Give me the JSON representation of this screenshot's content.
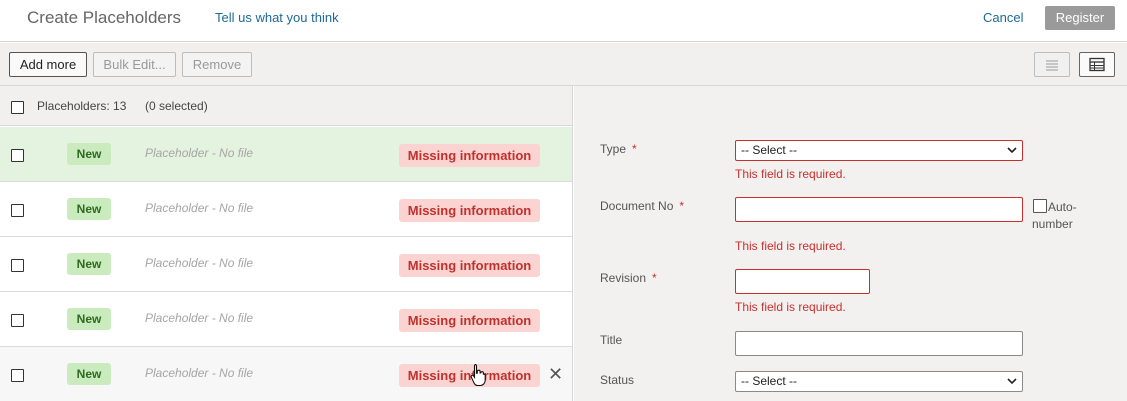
{
  "header": {
    "title": "Create Placeholders",
    "feedback_link": "Tell us what you think",
    "cancel_label": "Cancel",
    "register_label": "Register"
  },
  "toolbar": {
    "add_more_label": "Add more",
    "bulk_edit_label": "Bulk Edit...",
    "remove_label": "Remove",
    "view_list_icon": "list-view-icon",
    "view_table_icon": "table-view-icon"
  },
  "list": {
    "count_label": "Placeholders: 13",
    "selected_label": "(0 selected)",
    "rows": [
      {
        "status": "New",
        "text": "Placeholder - No file",
        "badge": "Missing information"
      },
      {
        "status": "New",
        "text": "Placeholder - No file",
        "badge": "Missing information"
      },
      {
        "status": "New",
        "text": "Placeholder - No file",
        "badge": "Missing information"
      },
      {
        "status": "New",
        "text": "Placeholder - No file",
        "badge": "Missing information"
      },
      {
        "status": "New",
        "text": "Placeholder - No file",
        "badge": "Missing information"
      }
    ],
    "remove_row_icon": "close-icon"
  },
  "form": {
    "type_label": "Type",
    "type_value": "-- Select --",
    "document_no_label": "Document No",
    "revision_label": "Revision",
    "title_label": "Title",
    "status_label": "Status",
    "status_value": "-- Select --",
    "required_marker": "*",
    "error_required": "This field is required.",
    "auto_number_label": "Auto-number"
  },
  "colors": {
    "error": "#c8302c",
    "link": "#1e6a96",
    "new_badge_bg": "#c9ebbd",
    "missing_badge_bg": "#fbd4d2",
    "selected_row_bg": "#e4f3df"
  }
}
